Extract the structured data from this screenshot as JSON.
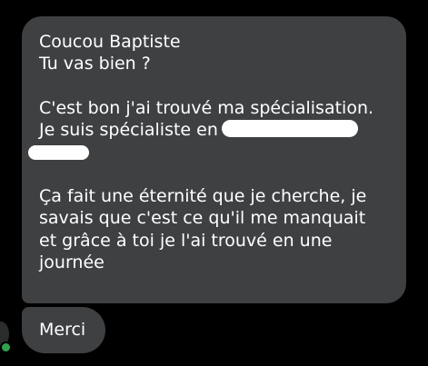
{
  "messages": [
    {
      "lines": [
        "Coucou Baptiste",
        "Tu vas bien ?",
        "",
        "C'est bon j'ai trouvé ma spécialisation.",
        "Je suis spécialiste en",
        "",
        "Ça fait une éternité que je cherche, je",
        "savais que c'est ce qu'il me manquait",
        "et grâce à toi je l'ai trouvé en une",
        "journée"
      ]
    },
    {
      "text": "Merci"
    }
  ],
  "colors": {
    "background": "#000000",
    "bubble": "#3e4042",
    "text": "#ffffff",
    "online_status": "#31a24c"
  },
  "icons": [
    "avatar",
    "online-status-dot-icon"
  ]
}
